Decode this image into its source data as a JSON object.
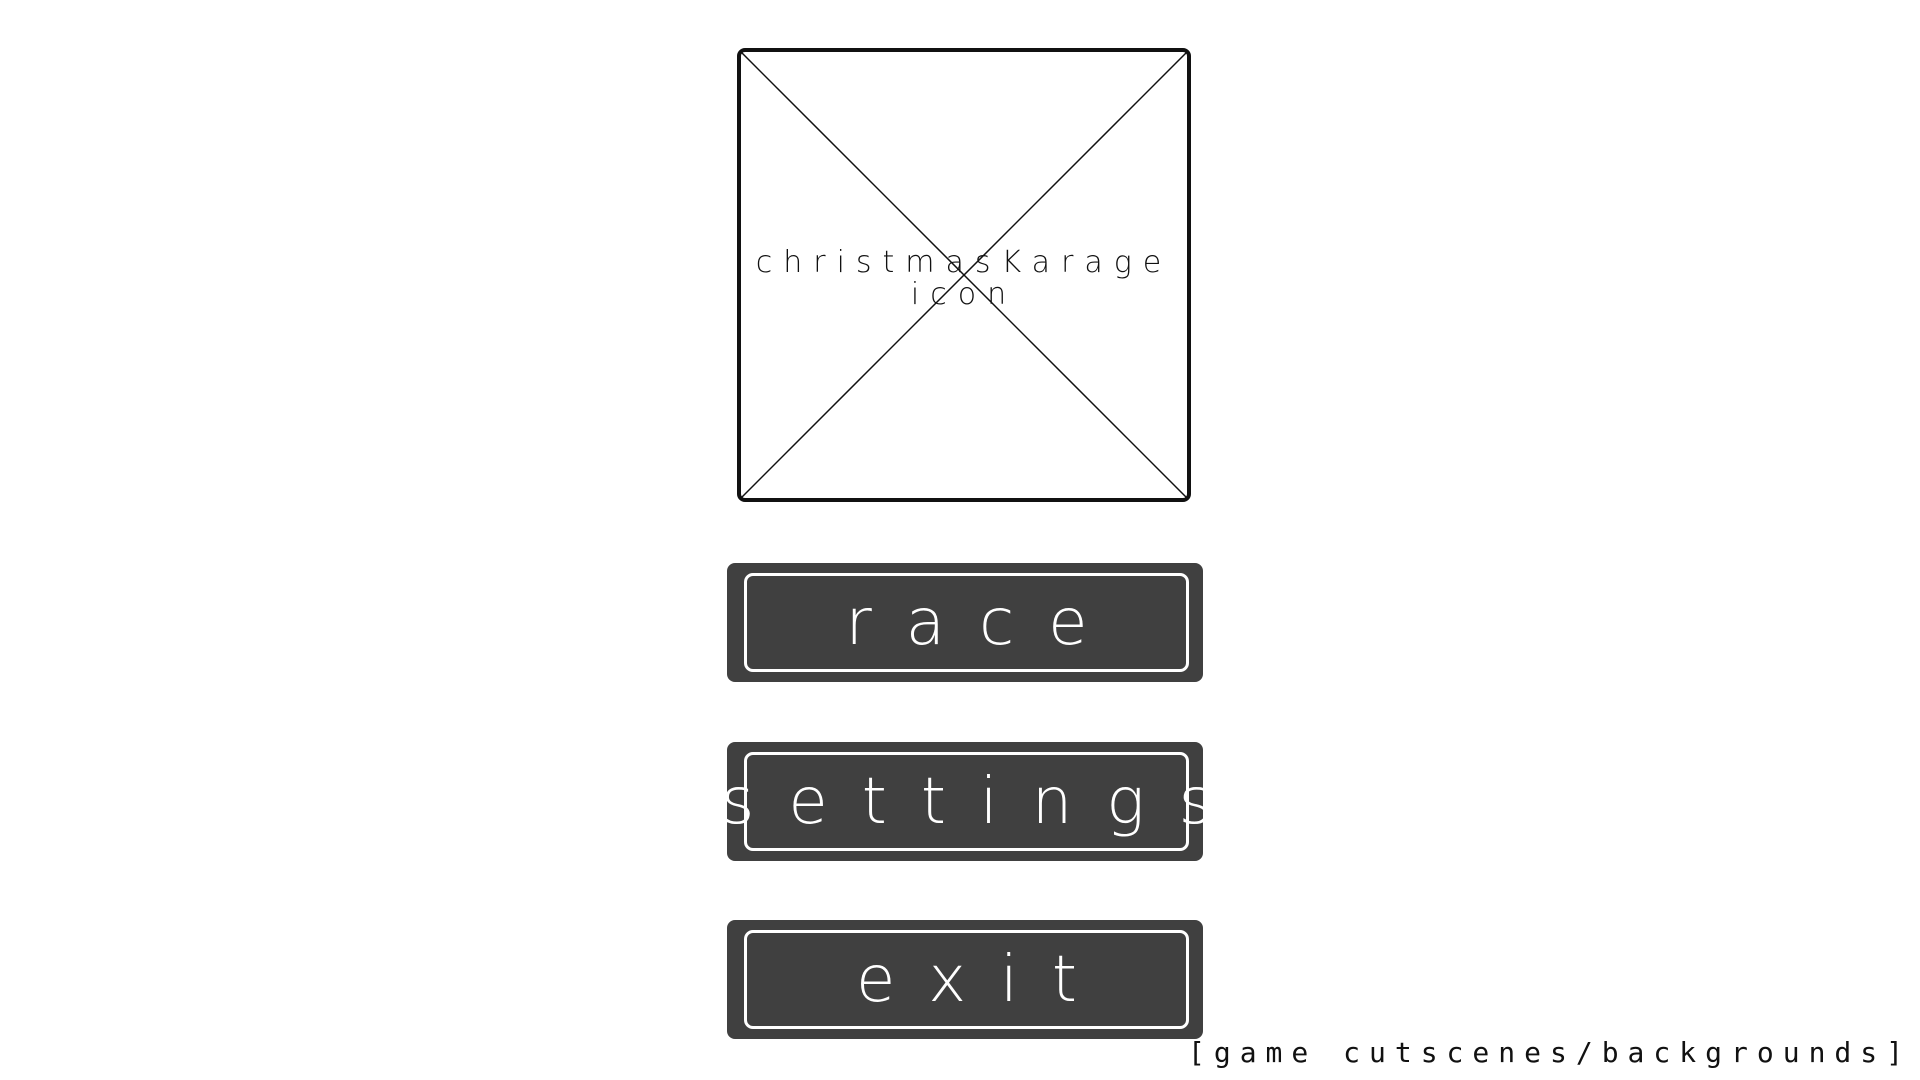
{
  "logo": {
    "line1": "christmasKarage",
    "line2": "icon"
  },
  "menu": {
    "race_label": "race",
    "settings_label": "settings",
    "exit_label": "exit"
  },
  "footer": {
    "note": "[game cutscenes/backgrounds]"
  },
  "colors": {
    "background": "#ffffff",
    "button_fill": "#404040",
    "button_text": "#ffffff",
    "outline": "#111111"
  }
}
